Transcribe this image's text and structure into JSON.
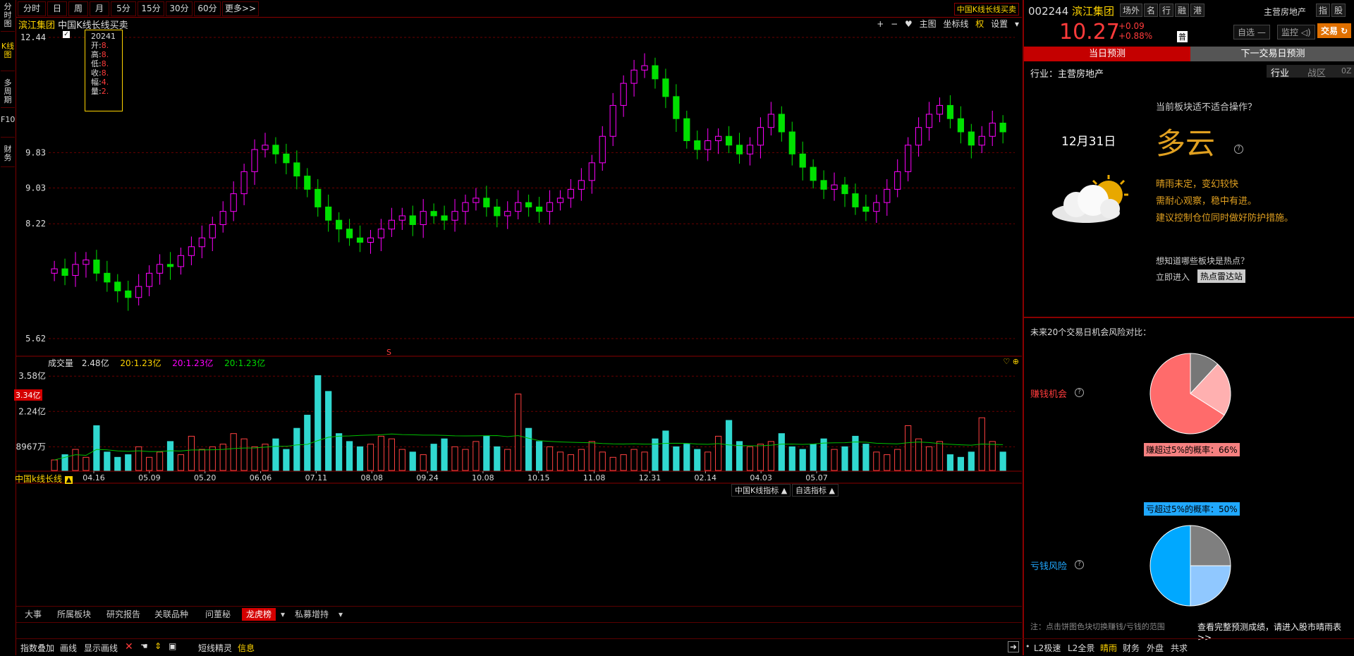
{
  "left_tabs": [
    "分时图",
    "K线图",
    "多周期",
    "F10",
    "财务"
  ],
  "periods": [
    "分时",
    "日",
    "周",
    "月",
    "5分",
    "15分",
    "30分",
    "60分",
    "更多>>"
  ],
  "top_right_tag": "中国K线长线买卖",
  "chart": {
    "stock_name": "滨江集团",
    "indicator_name": "中国K线长线买卖",
    "tools": [
      "+",
      "−",
      "♥",
      "主图",
      "坐标线",
      "权",
      "设置",
      "▾"
    ],
    "price_ticks": [
      "12.44",
      "9.83",
      "9.03",
      "8.22",
      "5.62"
    ],
    "tooltip": {
      "date": "20241",
      "rows": [
        {
          "label": "开:",
          "value": "8."
        },
        {
          "label": "高:",
          "value": "8."
        },
        {
          "label": "低:",
          "value": "8."
        },
        {
          "label": "收:",
          "value": "8."
        },
        {
          "label": "幅:",
          "value": "4."
        },
        {
          "label": "量:",
          "value": "2."
        }
      ]
    },
    "marker": "S",
    "volume": {
      "label": "成交量",
      "value": "2.48亿",
      "ma1": "20:1.23亿",
      "ma2": "20:1.23亿",
      "ma3": "20:1.23亿",
      "ticks": [
        "3.58亿",
        "2.24亿",
        "8967万"
      ],
      "highlight_tick": "3.34亿"
    },
    "date_axis": [
      "04.16",
      "05.09",
      "05.20",
      "06.06",
      "07.11",
      "08.08",
      "09.24",
      "10.08",
      "10.15",
      "11.08",
      "12.31",
      "02.14",
      "04.03",
      "05.07"
    ],
    "indicator_tab": "中国k线长线",
    "indicator_btn1": "中国K线指标 ▲",
    "indicator_btn2": "自选指标 ▲"
  },
  "chart_data": {
    "type": "candlestick",
    "title": "",
    "series": [
      {
        "name": "price",
        "values": [
          7.2,
          7.05,
          7.3,
          7.4,
          7.1,
          6.9,
          6.7,
          6.55,
          6.8,
          7.1,
          7.3,
          7.25,
          7.5,
          7.7,
          7.9,
          8.2,
          8.5,
          8.9,
          9.4,
          9.9,
          10.0,
          9.8,
          9.6,
          9.3,
          9.0,
          8.6,
          8.3,
          8.1,
          7.9,
          7.8,
          7.9,
          8.1,
          8.3,
          8.4,
          8.2,
          8.5,
          8.4,
          8.3,
          8.5,
          8.7,
          8.8,
          8.6,
          8.4,
          8.5,
          8.7,
          8.6,
          8.5,
          8.7,
          8.8,
          9.0,
          9.2,
          9.6,
          10.2,
          10.9,
          11.4,
          11.7,
          11.8,
          11.5,
          11.1,
          10.6,
          10.1,
          9.9,
          10.1,
          10.2,
          10.0,
          9.8,
          10.0,
          10.4,
          10.7,
          10.3,
          9.8,
          9.5,
          9.2,
          9.0,
          9.1,
          8.9,
          8.6,
          8.5,
          8.7,
          9.0,
          9.4,
          10.0,
          10.4,
          10.7,
          10.9,
          10.6,
          10.3,
          10.0,
          10.2,
          10.5,
          10.3
        ]
      },
      {
        "name": "volume",
        "values": [
          0.4,
          0.6,
          0.8,
          0.5,
          1.7,
          0.7,
          0.5,
          0.6,
          0.9,
          0.5,
          0.7,
          1.1,
          0.6,
          1.3,
          0.8,
          0.9,
          1.0,
          1.4,
          1.2,
          0.9,
          1.0,
          1.2,
          0.8,
          1.6,
          2.1,
          3.6,
          3.0,
          1.4,
          1.1,
          0.9,
          1.0,
          1.3,
          1.2,
          0.8,
          0.7,
          0.6,
          1.0,
          1.2,
          0.9,
          0.8,
          1.1,
          1.3,
          0.9,
          0.8,
          2.9,
          1.6,
          1.1,
          0.9,
          0.7,
          0.6,
          0.8,
          1.1,
          0.7,
          0.5,
          0.6,
          0.8,
          0.7,
          1.2,
          1.5,
          0.9,
          1.0,
          0.8,
          0.7,
          1.3,
          1.9,
          1.1,
          0.9,
          1.0,
          1.1,
          1.4,
          0.9,
          0.8,
          1.0,
          1.2,
          0.8,
          0.9,
          1.3,
          1.0,
          0.7,
          0.6,
          0.8,
          1.7,
          1.2,
          0.9,
          1.1,
          0.6,
          0.5,
          0.7,
          2.0,
          1.1,
          0.7
        ]
      }
    ],
    "xlabel": "",
    "ylabel": "",
    "ylim": [
      5.62,
      12.44
    ]
  },
  "bottom_tabs": [
    "大事",
    "所属板块",
    "研究报告",
    "关联品种",
    "问董秘",
    "龙虎榜",
    "私募增持"
  ],
  "bottom_active_tab": "龙虎榜",
  "ticker_text": "",
  "statusbar": {
    "items": [
      "指数叠加",
      "画线",
      "显示画线",
      "短线精灵",
      "信息"
    ]
  },
  "right": {
    "code": "002244",
    "name": "滨江集团",
    "mini_tabs": [
      "场外",
      "名",
      "行",
      "融",
      "港"
    ],
    "sector": "主营房地产",
    "sector_btns": [
      "指",
      "股"
    ],
    "price": "10.27",
    "change": "+0.09",
    "change_pct": "+0.88%",
    "badge": "普",
    "btn_zixuan": "自选 —",
    "btn_jiankong": "监控 ◁)",
    "btn_trade": "交易 ↻",
    "tab_today": "当日预测",
    "tab_next": "下一交易日预测",
    "industry_label": "行业：主营房地产",
    "industry_tabs": [
      "行业",
      "战区",
      "0Z"
    ],
    "question": "当前板块适不适合操作？",
    "date": "12月31日",
    "weather": "多云",
    "advice": [
      "晴雨未定，变幻较快",
      "需耐心观察，稳中有进。",
      "建议控制仓位同时做好防护措施。"
    ],
    "hot_question": "想知道哪些板块是热点？",
    "hot_enter": "立即进入",
    "hot_btn": "热点雷达站",
    "future_title": "未来20个交易日机会风险对比：",
    "earn_label": "赚钱机会",
    "earn_prob": "赚超过5%的概率：66%",
    "earn_pct": 66,
    "loss_label": "亏钱风险",
    "loss_prob": "亏超过5%的概率：50%",
    "loss_pct": 50,
    "note": "注：点击饼图色块切换赚钱/亏钱的范围",
    "more": "查看完整预测成绩，请进入股市晴雨表>>",
    "status_items": [
      "L2极速",
      "L2全景",
      "晴雨",
      "财务",
      "外盘",
      "共求"
    ]
  }
}
